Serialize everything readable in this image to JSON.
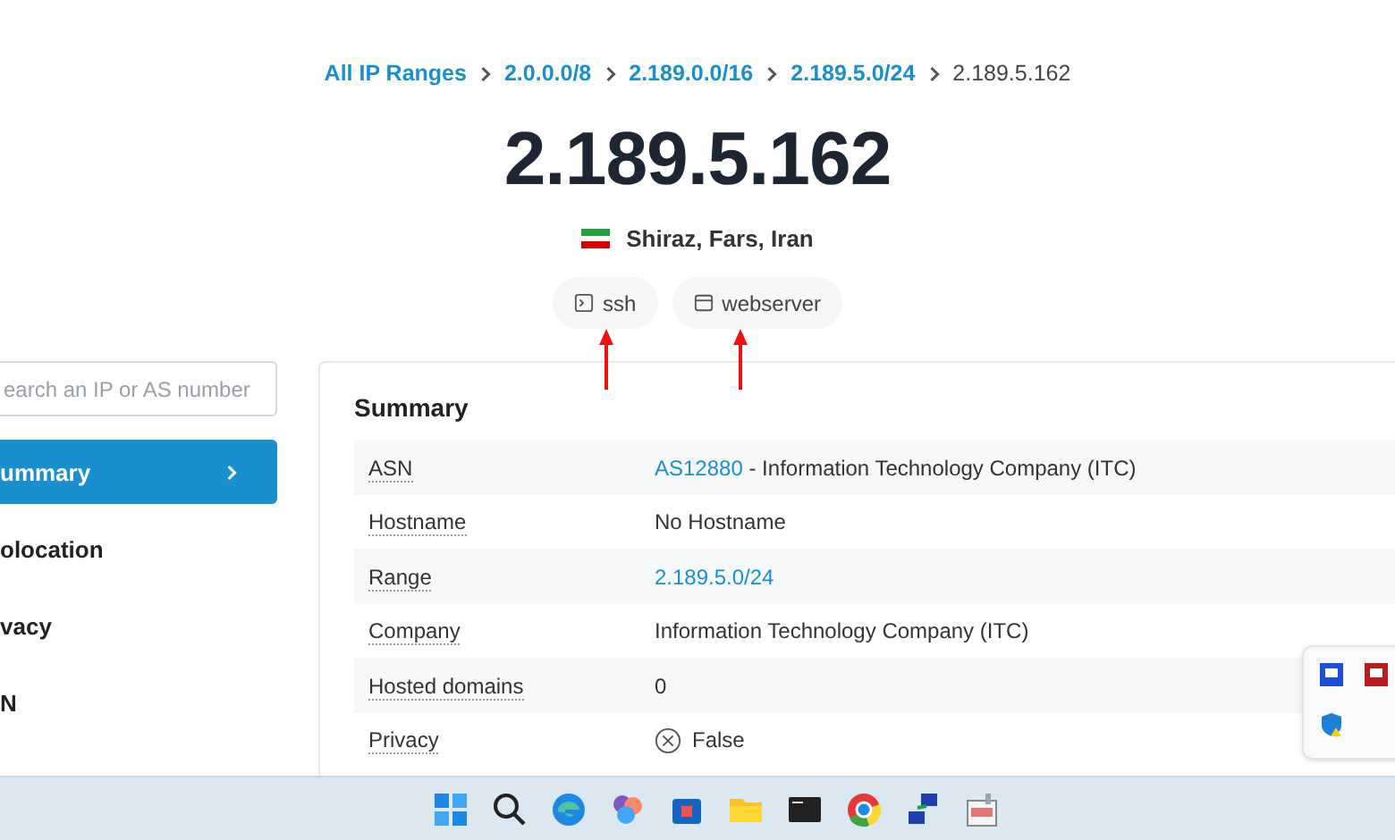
{
  "breadcrumbs": [
    {
      "label": "All IP Ranges",
      "kind": "link"
    },
    {
      "label": "2.0.0.0/8",
      "kind": "link"
    },
    {
      "label": "2.189.0.0/16",
      "kind": "link"
    },
    {
      "label": "2.189.5.0/24",
      "kind": "link"
    },
    {
      "label": "2.189.5.162",
      "kind": "current"
    }
  ],
  "title": "2.189.5.162",
  "location": "Shiraz, Fars, Iran",
  "tags": [
    {
      "label": "ssh",
      "kind": "terminal"
    },
    {
      "label": "webserver",
      "kind": "window"
    }
  ],
  "search": {
    "placeholder": "earch an IP or AS number"
  },
  "sidebar": {
    "items": [
      {
        "label": "ummary",
        "selected": true
      },
      {
        "label": "olocation",
        "selected": false
      },
      {
        "label": "vacy",
        "selected": false
      },
      {
        "label": "N",
        "selected": false
      }
    ]
  },
  "summary": {
    "title": "Summary",
    "rows": [
      {
        "label": "ASN",
        "link": "AS12880",
        "text": " - Information Technology Company (ITC)"
      },
      {
        "label": "Hostname",
        "text": "No Hostname"
      },
      {
        "label": "Range",
        "link": "2.189.5.0/24"
      },
      {
        "label": "Company",
        "text": "Information Technology Company (ITC)"
      },
      {
        "label": "Hosted domains",
        "text": "0"
      },
      {
        "label": "Privacy",
        "text": "False",
        "kind": "false"
      }
    ]
  }
}
